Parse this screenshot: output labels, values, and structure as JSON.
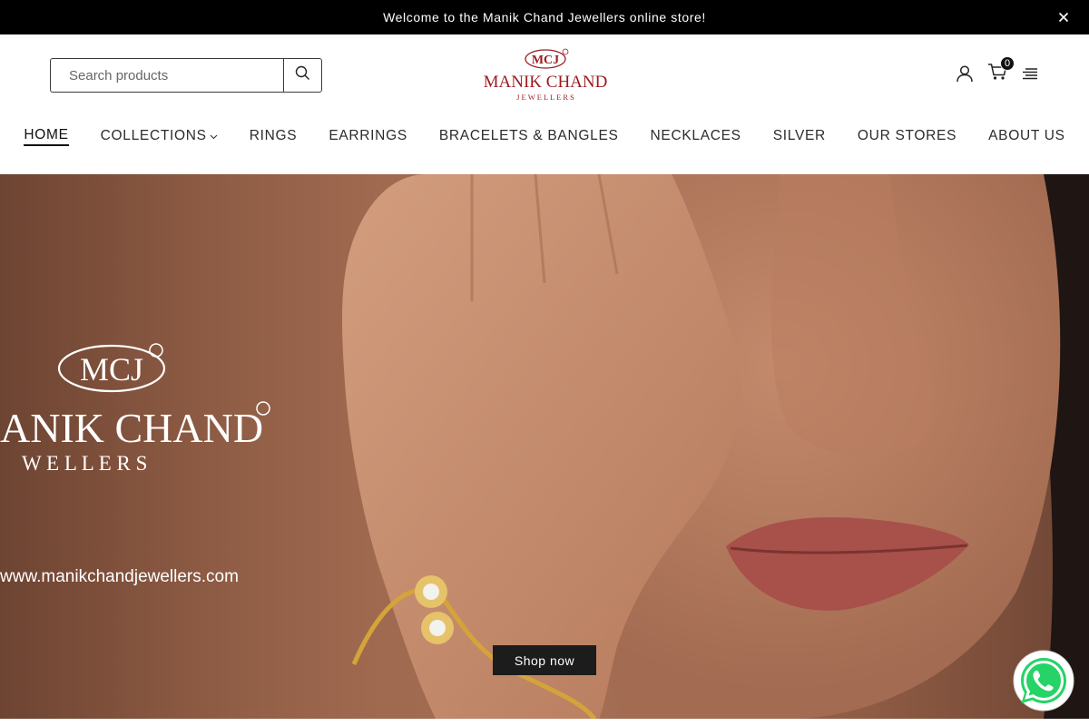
{
  "announcement": {
    "text": "Welcome to the Manik Chand Jewellers online store!"
  },
  "header": {
    "search": {
      "placeholder": "Search products",
      "value": ""
    },
    "logo": {
      "monogram": "MCJ",
      "name": "MANIK CHAND",
      "tagline": "J E W E L L E R S"
    },
    "cart_count": "0",
    "icons": [
      "user-icon",
      "cart-icon",
      "menu-icon",
      "search-icon",
      "close-icon"
    ]
  },
  "nav": {
    "items": [
      {
        "label": "HOME",
        "active": true
      },
      {
        "label": "COLLECTIONS",
        "has_dropdown": true
      },
      {
        "label": "RINGS"
      },
      {
        "label": "EARRINGS"
      },
      {
        "label": "BRACELETS & BANGLES"
      },
      {
        "label": "NECKLACES"
      },
      {
        "label": "SILVER"
      },
      {
        "label": "OUR STORES"
      },
      {
        "label": "ABOUT US"
      }
    ]
  },
  "hero": {
    "brand_monogram": "MCJ",
    "brand_name": "ANIK CHAND",
    "brand_tagline": "W E L L E R S",
    "url": "www.manikchandjewellers.com",
    "cta_label": "Shop now"
  },
  "colors": {
    "accent": "#000000",
    "logo_red": "#9b1b1f",
    "hero_skin": "#a06a50",
    "whatsapp_green": "#25d366"
  }
}
